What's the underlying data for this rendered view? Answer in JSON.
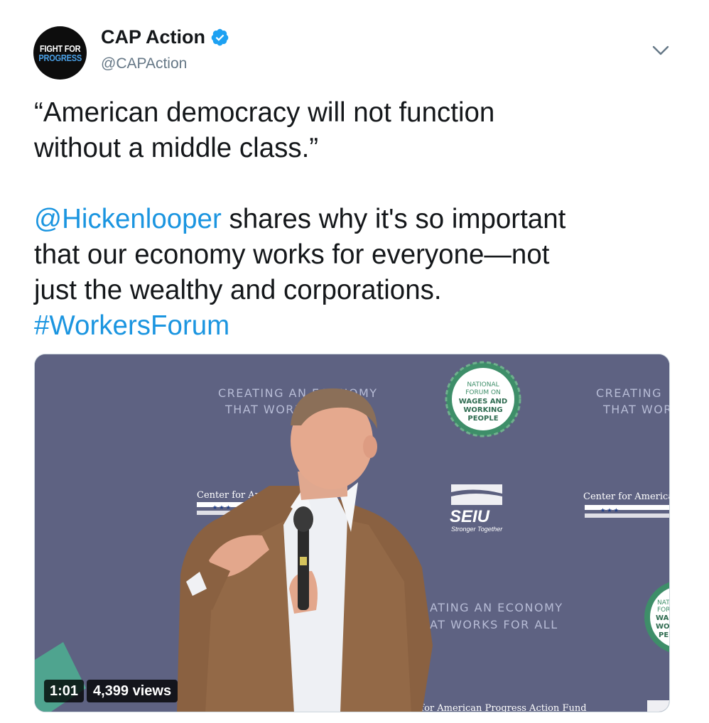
{
  "account": {
    "avatar_line1": "FIGHT FOR",
    "avatar_line2": "PROGRESS",
    "display_name": "CAP Action",
    "handle": "@CAPAction",
    "verified": true,
    "icons": {
      "verified": "verified-badge-icon",
      "menu": "chevron-down-icon"
    }
  },
  "tweet": {
    "quote": "“American democracy will not function\nwithout a middle class.”",
    "mention": "@Hickenlooper",
    "text_after_mention": " shares why it's so important\nthat our economy works for everyone—not\njust the wealthy and corporations.",
    "hashtag": "#WorkersForum"
  },
  "media": {
    "duration": "1:01",
    "views": "4,399 views",
    "backdrop": {
      "slogan_line1": "CREATING AN ECONOMY",
      "slogan_line2": "THAT WORKS",
      "slogan_right_line1": "CREATING",
      "slogan_right_line2": "THAT WOR",
      "slogan_bottom_line1": "ATING AN ECONOMY",
      "slogan_bottom_line2": "AT WORKS FOR ALL",
      "center_left": "Center for Ame",
      "center_right": "Center for America",
      "seal_lines": [
        "NATIONAL",
        "FORUM ON",
        "WAGES AND",
        "WORKING",
        "PEOPLE"
      ],
      "seal_partial": [
        "NAT",
        "FOR",
        "WAG",
        "WO",
        "PE"
      ],
      "seiu": "SEIU",
      "seiu_tagline": "Stronger Together",
      "footer_text": "ter for American Progress Action Fund"
    },
    "colors": {
      "backdrop": "#5b5f7e",
      "seal_green": "#3e8e69",
      "slogan": "#b7bcd6"
    }
  },
  "colors": {
    "link": "#1b95e0",
    "text": "#14171a",
    "muted": "#657786",
    "verified": "#1da1f2"
  }
}
